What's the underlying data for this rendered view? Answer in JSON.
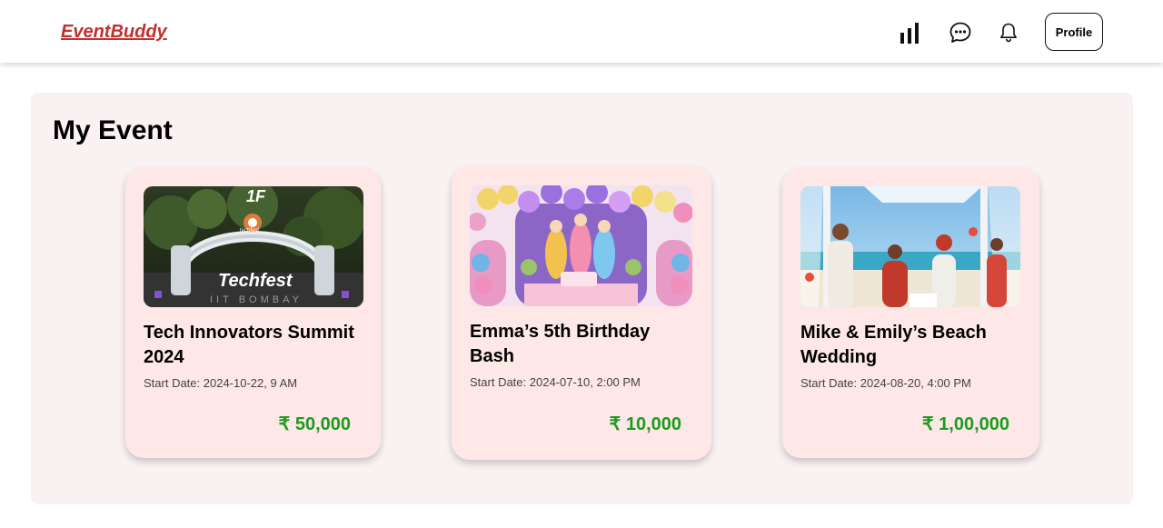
{
  "header": {
    "logo": "EventBuddy",
    "icons": [
      "stats-icon",
      "chat-icon",
      "bell-icon"
    ],
    "profile_label": "Profile"
  },
  "main": {
    "title": "My Event",
    "events": [
      {
        "title": "Tech Innovators Summit 2024",
        "start_date": "Start Date: 2024-10-22, 9 AM",
        "price": "₹ 50,000",
        "image_text_main": "Techfest",
        "image_text_sub": "IIT BOMBAY",
        "image_text_logo": "techfest"
      },
      {
        "title": "Emma’s 5th Birthday Bash",
        "start_date": "Start Date: 2024-07-10, 2:00 PM",
        "price": "₹ 10,000"
      },
      {
        "title": "Mike & Emily’s Beach Wedding",
        "start_date": "Start Date: 2024-08-20, 4:00 PM",
        "price": "₹ 1,00,000"
      }
    ]
  },
  "colors": {
    "logo": "#c0302e",
    "panel_bg": "#faf2f2",
    "card_bg": "#fde8e7",
    "price": "#1e9b1e"
  }
}
